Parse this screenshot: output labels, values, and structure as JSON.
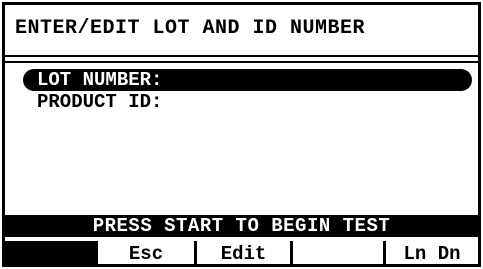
{
  "header": {
    "title": "ENTER/EDIT LOT AND ID NUMBER"
  },
  "menu": {
    "items": [
      {
        "label": "LOT NUMBER:",
        "selected": true
      },
      {
        "label": "PRODUCT ID:",
        "selected": false
      }
    ]
  },
  "status": {
    "message": "PRESS START TO BEGIN TEST"
  },
  "softkeys": {
    "keys": [
      {
        "label": ""
      },
      {
        "label": "Esc"
      },
      {
        "label": "Edit"
      },
      {
        "label": ""
      },
      {
        "label": "Ln Dn"
      }
    ]
  },
  "colors": {
    "foreground": "#000000",
    "background": "#ffffff"
  }
}
